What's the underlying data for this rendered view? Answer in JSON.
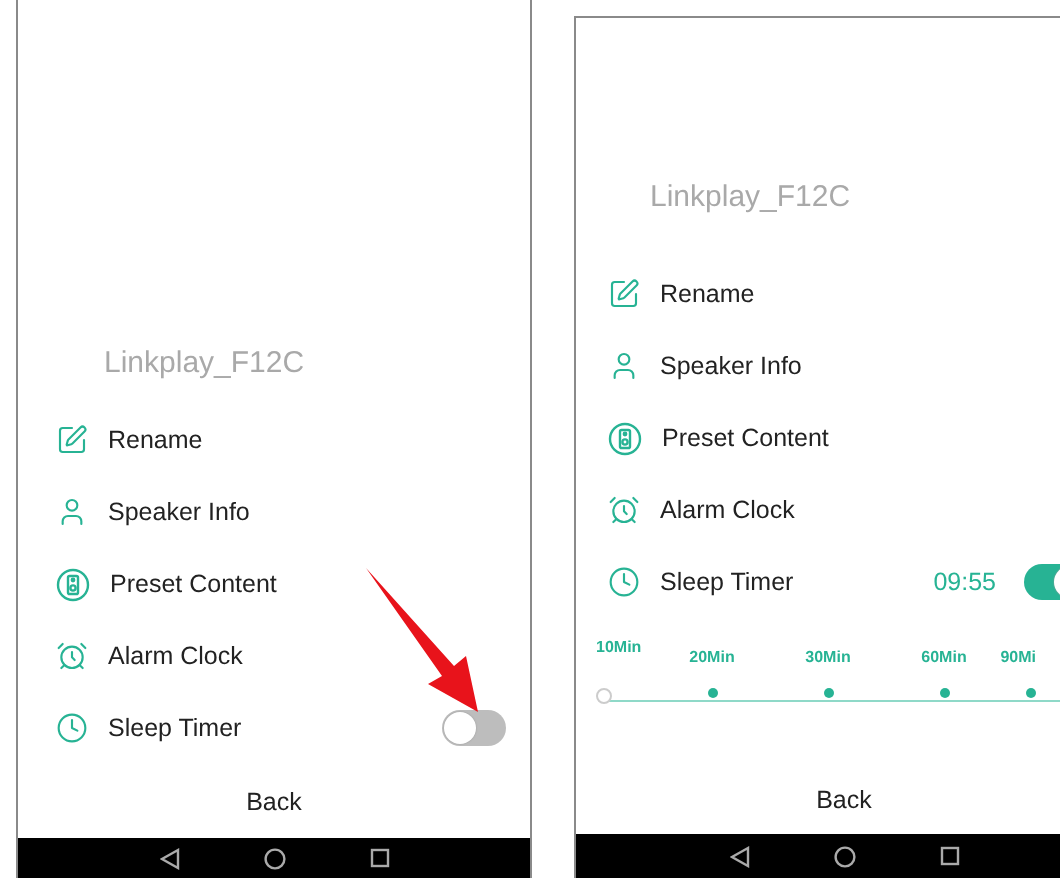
{
  "screens": [
    {
      "device_name": "Linkplay_F12C",
      "menu": [
        {
          "kind": "rename",
          "label": "Rename"
        },
        {
          "kind": "info",
          "label": "Speaker Info"
        },
        {
          "kind": "preset",
          "label": "Preset Content"
        },
        {
          "kind": "alarm",
          "label": "Alarm Clock"
        },
        {
          "kind": "sleep",
          "label": "Sleep Timer"
        }
      ],
      "sleep_timer": {
        "on": false
      },
      "annotation_arrow": true,
      "back": "Back"
    },
    {
      "device_name": "Linkplay_F12C",
      "menu": [
        {
          "kind": "rename",
          "label": "Rename"
        },
        {
          "kind": "info",
          "label": "Speaker Info"
        },
        {
          "kind": "preset",
          "label": "Preset Content"
        },
        {
          "kind": "alarm",
          "label": "Alarm Clock"
        },
        {
          "kind": "sleep",
          "label": "Sleep Timer"
        }
      ],
      "sleep_timer": {
        "on": true,
        "time": "09:55",
        "options": [
          {
            "label": "10Min",
            "selected": true
          },
          {
            "label": "20Min",
            "selected": false
          },
          {
            "label": "30Min",
            "selected": false
          },
          {
            "label": "60Min",
            "selected": false
          },
          {
            "label": "90Mi",
            "selected": false
          }
        ]
      },
      "annotation_arrow": false,
      "back": "Back"
    }
  ]
}
